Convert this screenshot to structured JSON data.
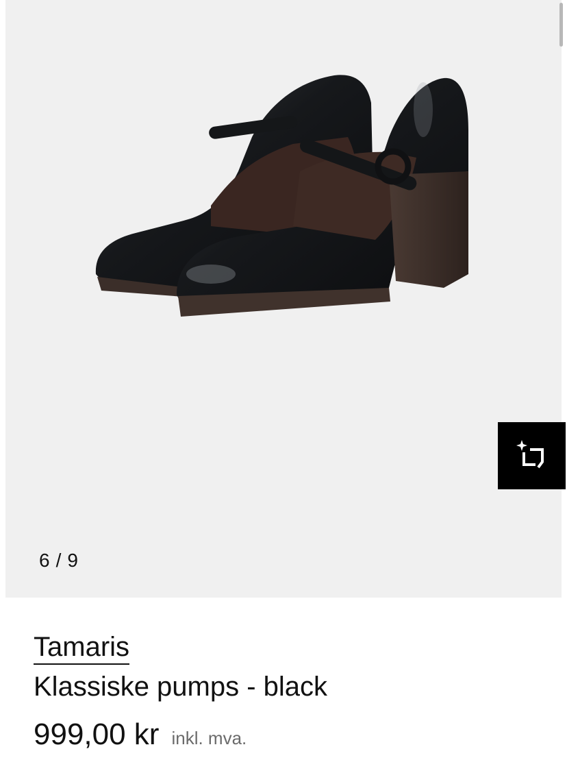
{
  "gallery": {
    "current_index": "6",
    "separator": "/",
    "total": "9",
    "image_subject": "black patent mary jane pumps with block heel",
    "background_color": "#f0f0f0",
    "try_on_icon": "sparkle-crop-icon"
  },
  "product": {
    "brand": "Tamaris",
    "name": "Klassiske pumps - black",
    "price": "999,00 kr",
    "vat_note": "inkl. mva."
  },
  "colors": {
    "text": "#111111",
    "muted": "#6b6b6b",
    "button_bg": "#000000"
  }
}
